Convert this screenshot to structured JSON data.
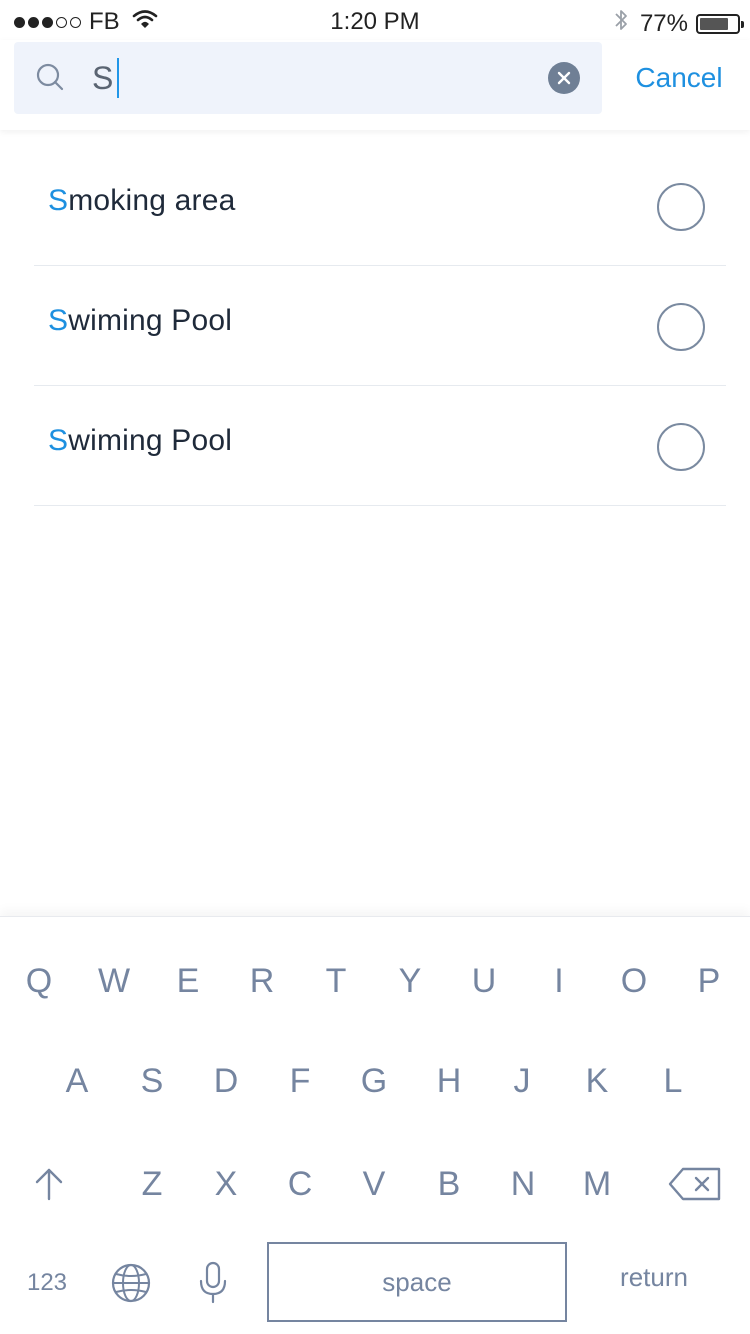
{
  "status_bar": {
    "carrier": "FB",
    "time": "1:20 PM",
    "battery_percent": "77%",
    "battery_level": 0.77,
    "signal_bars_filled": 3,
    "signal_bars_total": 5
  },
  "search": {
    "value": "S",
    "cancel_label": "Cancel",
    "accent_color": "#1e90e0"
  },
  "results": [
    {
      "match": "S",
      "rest": "moking area",
      "selected": false
    },
    {
      "match": "S",
      "rest": "wiming Pool",
      "selected": false
    },
    {
      "match": "S",
      "rest": "wiming Pool",
      "selected": false
    }
  ],
  "keyboard": {
    "row1": [
      "Q",
      "W",
      "E",
      "R",
      "T",
      "Y",
      "U",
      "I",
      "O",
      "P"
    ],
    "row2": [
      "A",
      "S",
      "D",
      "F",
      "G",
      "H",
      "J",
      "K",
      "L"
    ],
    "row3": [
      "Z",
      "X",
      "C",
      "V",
      "B",
      "N",
      "M"
    ],
    "numbers_label": "123",
    "space_label": "space",
    "return_label": "return",
    "icons": [
      "shift-icon",
      "backspace-icon",
      "globe-icon",
      "microphone-icon"
    ]
  }
}
